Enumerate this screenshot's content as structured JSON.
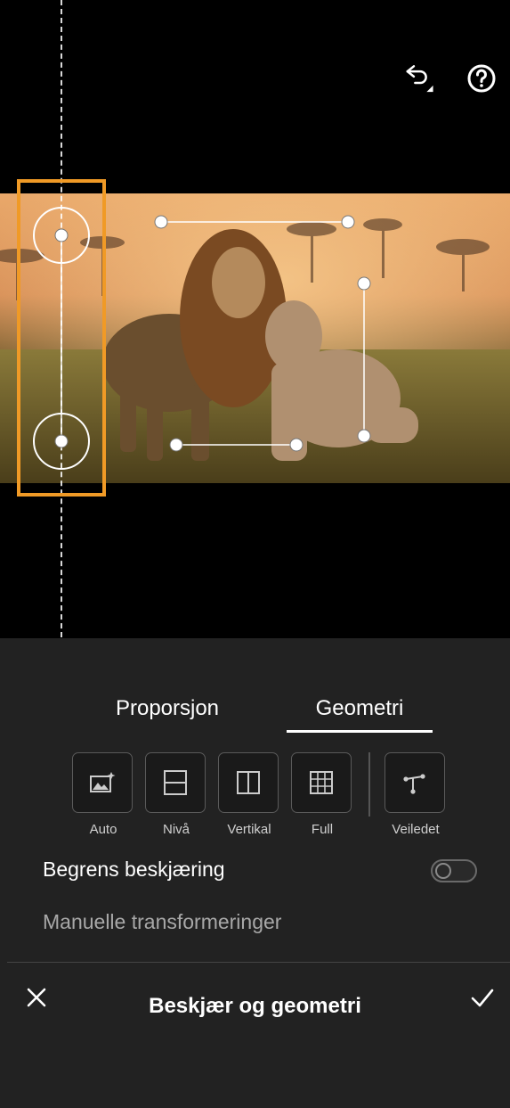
{
  "header": {
    "undo_icon": "undo-icon",
    "help_icon": "help-icon"
  },
  "tabs": [
    {
      "label": "Proporsjon",
      "active": false
    },
    {
      "label": "Geometri",
      "active": true
    }
  ],
  "upright_tools": [
    {
      "label": "Auto",
      "icon": "auto-upright-icon"
    },
    {
      "label": "Nivå",
      "icon": "level-icon"
    },
    {
      "label": "Vertikal",
      "icon": "vertical-icon"
    },
    {
      "label": "Full",
      "icon": "full-grid-icon"
    },
    {
      "label": "Veiledet",
      "icon": "guided-icon"
    }
  ],
  "constrain_crop": {
    "label": "Begrens beskjæring",
    "enabled": false
  },
  "manual_transforms": {
    "label": "Manuelle transformeringer"
  },
  "footer": {
    "title": "Beskjær og geometri",
    "cancel_icon": "close-icon",
    "confirm_icon": "checkmark-icon"
  },
  "colors": {
    "selection_highlight": "#f09a26",
    "panel_bg": "#222222"
  }
}
